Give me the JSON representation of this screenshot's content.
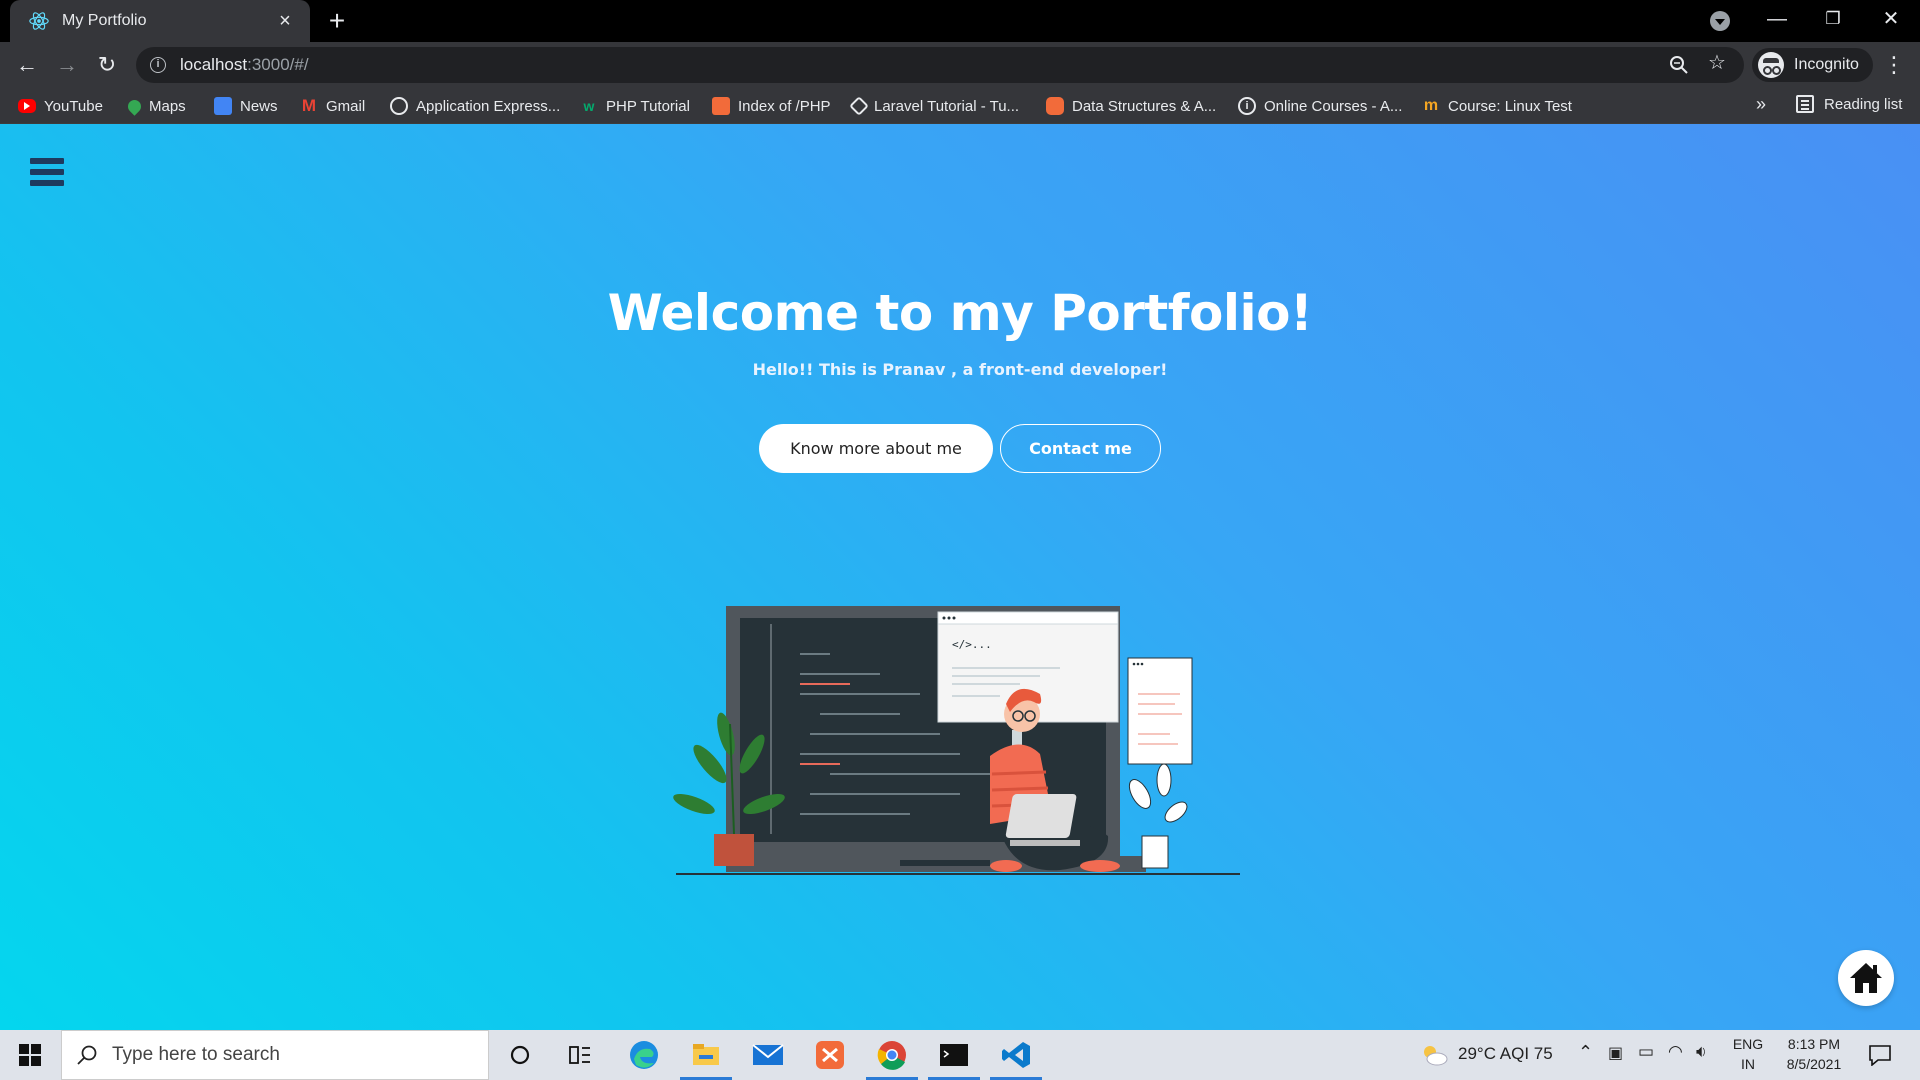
{
  "browser": {
    "tab": {
      "title": "My Portfolio",
      "close_icon": "×"
    },
    "new_tab_icon": "+",
    "window_controls": {
      "minimize": "—",
      "restore": "❐",
      "close": "✕"
    },
    "url": {
      "host": "localhost",
      "rest": ":3000/#/"
    },
    "profile_label": "Incognito",
    "bookmarks": [
      {
        "label": "YouTube",
        "color": "#ff0000"
      },
      {
        "label": "Maps",
        "color": "#34a853"
      },
      {
        "label": "News",
        "color": "#4285f4"
      },
      {
        "label": "Gmail",
        "color": "#ea4335"
      },
      {
        "label": "Application Express...",
        "color": "#e8eaed"
      },
      {
        "label": "PHP Tutorial",
        "color": "#04aa6d"
      },
      {
        "label": "Index of /PHP",
        "color": "#f26b3a"
      },
      {
        "label": "Laravel Tutorial - Tu...",
        "color": "#e8eaed"
      },
      {
        "label": "Data Structures & A...",
        "color": "#f26b3a"
      },
      {
        "label": "Online Courses - A...",
        "color": "#e8eaed"
      },
      {
        "label": "Course: Linux Test",
        "color": "#f5a623"
      }
    ],
    "bookmarks_more": "»",
    "reading_list_label": "Reading list"
  },
  "page": {
    "title": "Welcome to my Portfolio!",
    "subtitle": "Hello!! This is Pranav , a front-end developer!",
    "buttons": {
      "about": "Know more about me",
      "contact": "Contact me"
    },
    "illustration": {
      "code_tag": "</>..."
    }
  },
  "taskbar": {
    "search_placeholder": "Type here to search",
    "weather": "29°C  AQI 75",
    "lang_top": "ENG",
    "lang_bottom": "IN",
    "time": "8:13 PM",
    "date": "8/5/2021"
  },
  "colors": {
    "page_gradient_start": "#04d6ee",
    "page_gradient_end": "#4990f4",
    "accent": "#2b7bd6"
  }
}
